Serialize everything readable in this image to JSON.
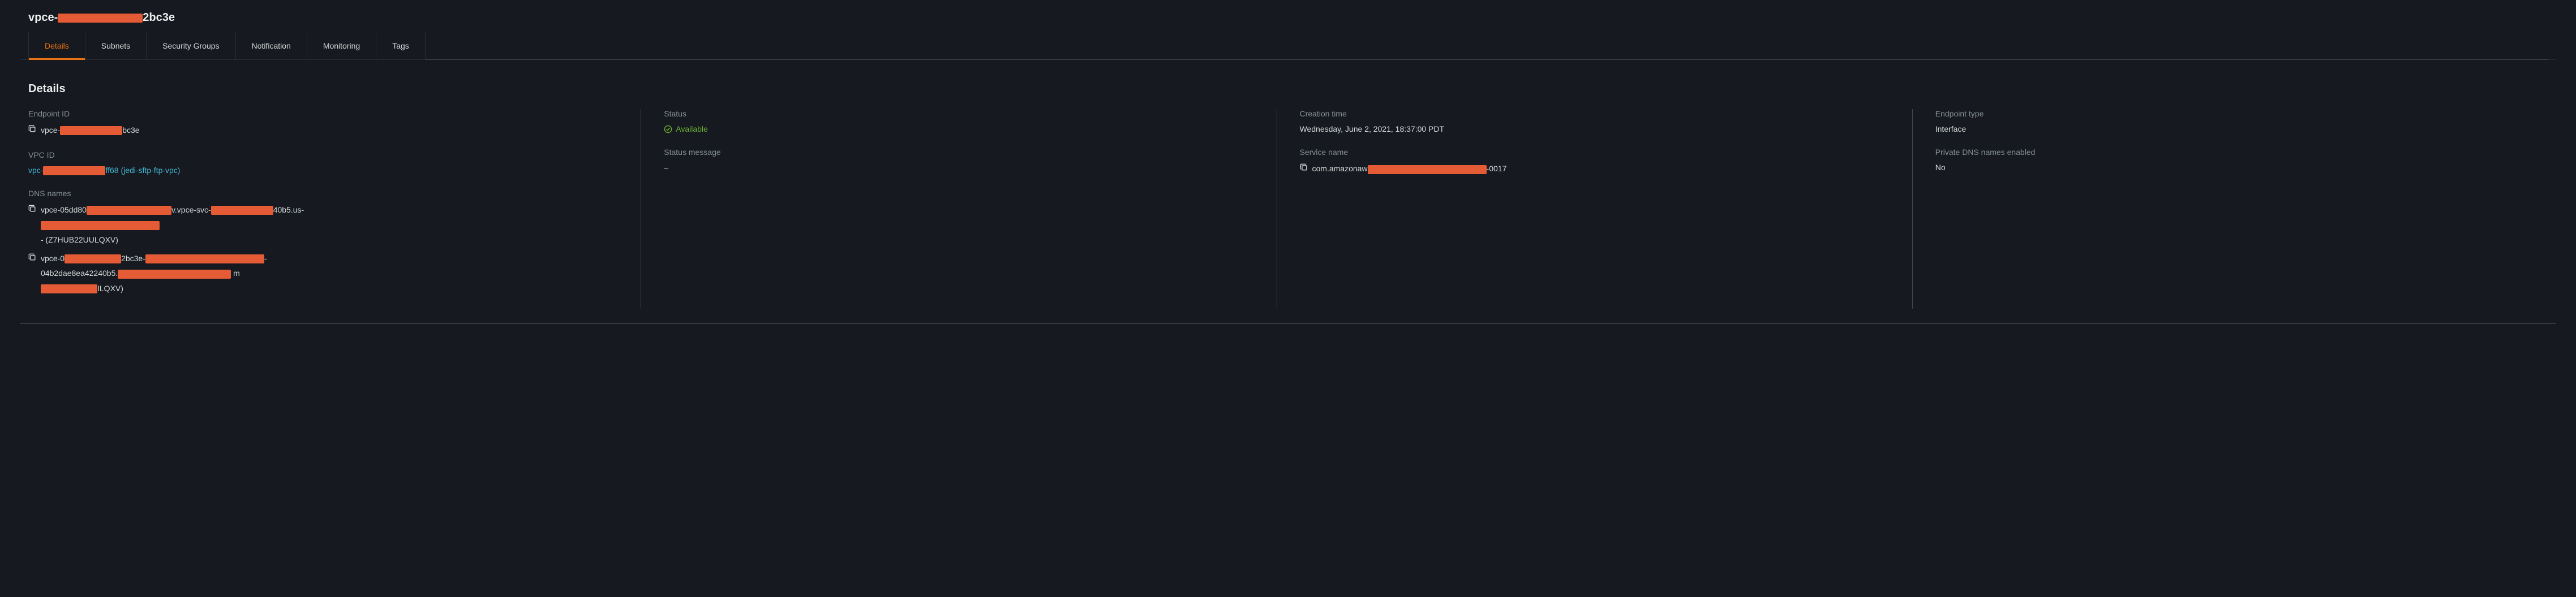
{
  "header": {
    "title_prefix": "vpce-",
    "title_suffix": "2bc3e"
  },
  "tabs": {
    "details": "Details",
    "subnets": "Subnets",
    "security_groups": "Security Groups",
    "notification": "Notification",
    "monitoring": "Monitoring",
    "tags": "Tags"
  },
  "panel": {
    "title": "Details"
  },
  "fields": {
    "endpoint_id": {
      "label": "Endpoint ID",
      "prefix": "vpce-",
      "suffix": "bc3e"
    },
    "vpc_id": {
      "label": "VPC ID",
      "prefix": "vpc-",
      "suffix": "ff68 (jedi-sftp-ftp-vpc)"
    },
    "dns_names": {
      "label": "DNS names",
      "line1_prefix": "vpce-05dd80",
      "line1_mid": "v.vpce-svc-",
      "line1_suffix": "40b5.us-",
      "line2_suffix": "- (Z7HUB22UULQXV)",
      "line3_prefix": "vpce-0",
      "line3_mid1": "2bc3e-",
      "line3_tail": "-",
      "line4_prefix": "04b2dae8ea42240b5.",
      "line4_suffix": "m",
      "line5_suffix": "ILQXV)"
    },
    "status": {
      "label": "Status",
      "value": "Available"
    },
    "status_message": {
      "label": "Status message",
      "value": "–"
    },
    "creation_time": {
      "label": "Creation time",
      "value": "Wednesday, June 2, 2021, 18:37:00 PDT"
    },
    "service_name": {
      "label": "Service name",
      "prefix": "com.amazonaw",
      "suffix": "-0017"
    },
    "endpoint_type": {
      "label": "Endpoint type",
      "value": "Interface"
    },
    "private_dns": {
      "label": "Private DNS names enabled",
      "value": "No"
    }
  }
}
